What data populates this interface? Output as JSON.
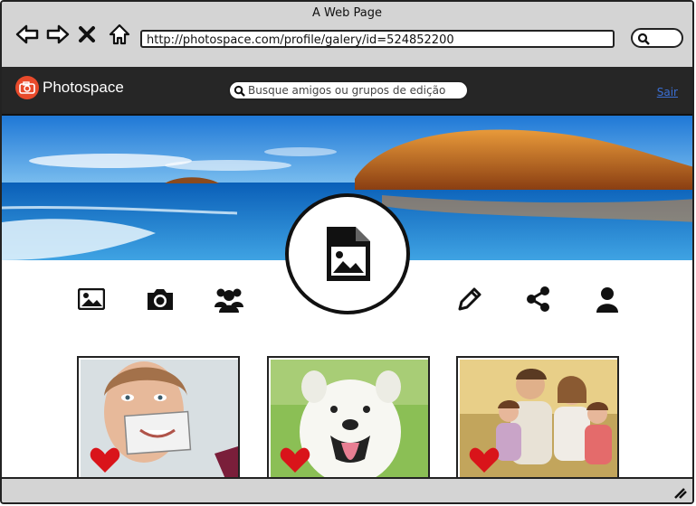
{
  "window": {
    "title": "A Web Page"
  },
  "browser": {
    "url": "http://photospace.com/profile/galery/id=524852200"
  },
  "app": {
    "name": "Photospace",
    "search_placeholder": "Busque amigos ou grupos de edição",
    "logout_label": "Sair"
  },
  "colors": {
    "brand": "#e84a2b",
    "appbar": "#262626",
    "link": "#3b6fd4",
    "heart": "#d9141a"
  },
  "profile": {
    "left_icons": [
      "image-icon",
      "camera-icon",
      "group-icon"
    ],
    "right_icons": [
      "edit-icon",
      "share-icon",
      "user-icon"
    ],
    "avatar_icon": "image-file-icon"
  },
  "gallery": [
    {
      "subject": "woman-smile-photo",
      "liked": true
    },
    {
      "subject": "white-dog-photo",
      "liked": true
    },
    {
      "subject": "family-photo",
      "liked": true
    }
  ]
}
